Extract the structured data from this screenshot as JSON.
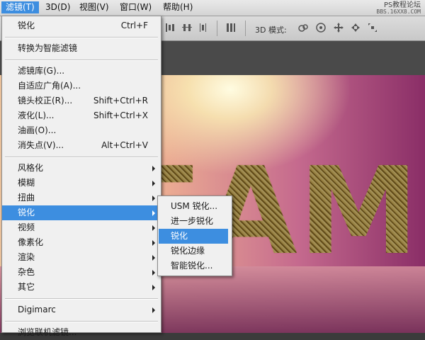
{
  "menubar": {
    "items": [
      {
        "label": "滤镜(T)",
        "active": true
      },
      {
        "label": "3D(D)"
      },
      {
        "label": "视图(V)"
      },
      {
        "label": "窗口(W)"
      },
      {
        "label": "帮助(H)"
      }
    ],
    "watermark_line1": "PS教程论坛",
    "watermark_line2": "BBS.16XX8.COM"
  },
  "optionsbar": {
    "mode_label": "3D 模式:",
    "icons": [
      "align-icon",
      "distribute-icon",
      "distribute-center-icon",
      "auto-align-icon",
      "rotate-3d-icon",
      "roll-3d-icon",
      "pan-3d-icon",
      "slide-3d-icon",
      "scale-3d-icon"
    ]
  },
  "canvas": {
    "text": "EAM"
  },
  "filter_menu": {
    "items": [
      {
        "label": "锐化",
        "shortcut": "Ctrl+F"
      },
      {
        "separator": true
      },
      {
        "label": "转换为智能滤镜"
      },
      {
        "separator": true
      },
      {
        "label": "滤镜库(G)..."
      },
      {
        "label": "自适应广角(A)..."
      },
      {
        "label": "镜头校正(R)...",
        "shortcut": "Shift+Ctrl+R"
      },
      {
        "label": "液化(L)...",
        "shortcut": "Shift+Ctrl+X"
      },
      {
        "label": "油画(O)..."
      },
      {
        "label": "消失点(V)...",
        "shortcut": "Alt+Ctrl+V"
      },
      {
        "separator": true
      },
      {
        "label": "风格化",
        "submenu": true
      },
      {
        "label": "模糊",
        "submenu": true
      },
      {
        "label": "扭曲",
        "submenu": true
      },
      {
        "label": "锐化",
        "submenu": true,
        "highlighted": true
      },
      {
        "label": "视频",
        "submenu": true
      },
      {
        "label": "像素化",
        "submenu": true
      },
      {
        "label": "渲染",
        "submenu": true
      },
      {
        "label": "杂色",
        "submenu": true
      },
      {
        "label": "其它",
        "submenu": true
      },
      {
        "separator": true
      },
      {
        "label": "Digimarc",
        "submenu": true
      },
      {
        "separator": true
      },
      {
        "label": "浏览联机滤镜..."
      }
    ]
  },
  "sharpen_submenu": {
    "items": [
      {
        "label": "USM 锐化..."
      },
      {
        "label": "进一步锐化"
      },
      {
        "label": "锐化",
        "highlighted": true
      },
      {
        "label": "锐化边缘"
      },
      {
        "label": "智能锐化..."
      }
    ]
  },
  "colors": {
    "highlight": "#3d8ee0",
    "menu_bg": "#f0f0f0",
    "canvas_gradient_left": "#f1c69f",
    "canvas_gradient_right": "#8a2e67"
  }
}
